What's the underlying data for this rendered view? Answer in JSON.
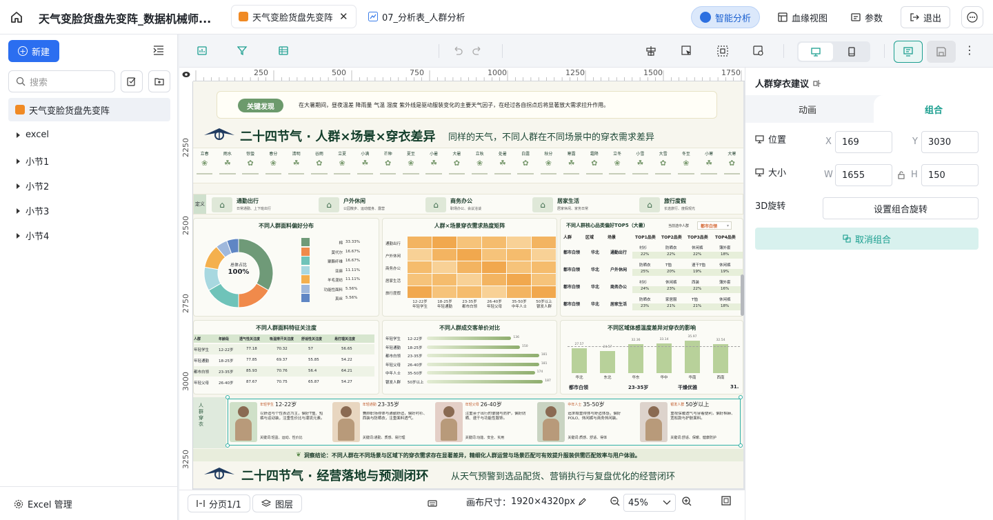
{
  "topbar": {
    "doc_title": "天气变脸货盘先变阵_数据机械师...",
    "tabs": [
      {
        "label": "天气变脸货盘先变阵",
        "active": true
      },
      {
        "label": "07_分析表_人群分析",
        "active": false
      }
    ],
    "smart_analysis": "智能分析",
    "lineage_view": "血缘视图",
    "params": "参数",
    "exit": "退出"
  },
  "sidebar": {
    "new_button": "新建",
    "search_placeholder": "搜索",
    "items": [
      {
        "label": "天气变脸货盘先变阵",
        "selected": true
      },
      {
        "label": "excel"
      },
      {
        "label": "小节1"
      },
      {
        "label": "小节2"
      },
      {
        "label": "小节3"
      },
      {
        "label": "小节4"
      }
    ],
    "excel_manage": "Excel 管理"
  },
  "rulers": {
    "top": [
      "250",
      "500",
      "750",
      "1000",
      "1250",
      "1500",
      "1750"
    ],
    "left": [
      "2250",
      "2500",
      "2750",
      "3000",
      "3250"
    ]
  },
  "report": {
    "key_finding_label": "关键发现",
    "key_finding_text": "在大暑期间，昼夜温差 降雨量 气温 湿度 紫外线是驱动服装变化的主要天气因子，在经过各自拐点后将显著放大需求拉升作用。",
    "section1_title": "二十四节气 · 人群×场景×穿衣差异",
    "section1_sub": "同样的天气，不同人群在不同场景中的穿衣需求差异",
    "solar_terms": [
      "立春",
      "雨水",
      "惊蛰",
      "春分",
      "清明",
      "谷雨",
      "立夏",
      "小满",
      "芒种",
      "夏至",
      "小暑",
      "大暑",
      "立秋",
      "处暑",
      "白露",
      "秋分",
      "寒露",
      "霜降",
      "立冬",
      "小雪",
      "大雪",
      "冬至",
      "小寒",
      "大寒"
    ],
    "scenes": [
      {
        "name": "通勤出行",
        "desc": "日常通勤、上下班出行"
      },
      {
        "name": "户外休闲",
        "desc": "公园散步、运动健身、露营"
      },
      {
        "name": "商务办公",
        "desc": "职场办公、会议洽谈"
      },
      {
        "name": "居家生活",
        "desc": "居家休闲、家务日常"
      },
      {
        "name": "旅行度假",
        "desc": "长途旅行、度假观光"
      }
    ],
    "scene_def_label": "定义",
    "donut_title": "不同人群面料偏好分布",
    "donut_center_label": "总体占比",
    "donut_center_value": "100%",
    "donut_legend": [
      {
        "name": "棉",
        "value": "33.33%",
        "color": "#6f9a78"
      },
      {
        "name": "莫代尔",
        "value": "16.67%",
        "color": "#f08a4b"
      },
      {
        "name": "聚酯纤维",
        "value": "16.67%",
        "color": "#6fc3b9"
      },
      {
        "name": "亚麻",
        "value": "11.11%",
        "color": "#a8d8e0"
      },
      {
        "name": "羊毛混纺",
        "value": "11.11%",
        "color": "#f4b04e"
      },
      {
        "name": "功能性面料",
        "value": "5.56%",
        "color": "#9fb8dc"
      },
      {
        "name": "真丝",
        "value": "5.56%",
        "color": "#5f86c4"
      }
    ],
    "heatmap_title": "人群×场景穿衣需求热度矩阵",
    "heatmap_rows": [
      "通勤出行",
      "户外休闲",
      "商务办公",
      "居家生活",
      "旅行度假"
    ],
    "heatmap_cols": [
      "12-22岁\n年轻学生",
      "18-25岁\n年轻通勤",
      "23-35岁\n都市白领",
      "26-40岁\n年轻父母",
      "35-50岁\n中年人士",
      "50岁以上\n银发人群"
    ],
    "top5_title": "不同人群核心品类偏好TOP5（大暑）",
    "top5_filter_label": "当前选中人群",
    "top5_filter_value": "都市白领",
    "top5_headers": [
      "人群",
      "区域",
      "场景",
      "TOP1品类",
      "TOP2品类",
      "TOP3品类",
      "TOP4品类"
    ],
    "top5_rows": [
      {
        "group": "都市白领",
        "region": "华北",
        "scene": "通勤出行",
        "items": [
          "衬衫",
          "防晒衣",
          "休闲裤",
          "薄外套"
        ],
        "pcts": [
          "22%",
          "22%",
          "22%",
          "18%"
        ]
      },
      {
        "group": "都市白领",
        "region": "华北",
        "scene": "户外休闲",
        "items": [
          "防晒衣",
          "T恤",
          "速干T恤",
          "休闲裤"
        ],
        "pcts": [
          "25%",
          "20%",
          "19%",
          "19%"
        ]
      },
      {
        "group": "都市白领",
        "region": "华北",
        "scene": "商务办公",
        "items": [
          "衬衫",
          "休闲裤",
          "西装",
          "薄外套"
        ],
        "pcts": [
          "24%",
          "23%",
          "22%",
          "16%"
        ]
      },
      {
        "group": "都市白领",
        "region": "华北",
        "scene": "居家生活",
        "items": [
          "防晒衣",
          "家居服",
          "T恤",
          "休闲裤"
        ],
        "pcts": [
          "23%",
          "21%",
          "21%",
          "18%"
        ]
      }
    ],
    "fabric_table_title": "不同人群面料特征关注度",
    "fabric_headers": [
      "人群",
      "年龄段",
      "透气性关注度",
      "吸湿排汗关注度",
      "舒适性关注度",
      "易打理关注度"
    ],
    "fabric_rows": [
      [
        "年轻学生",
        "12-22岁",
        "77.18",
        "70.32",
        "57",
        "56.65"
      ],
      [
        "年轻通勤",
        "18-25岁",
        "77.85",
        "69.37",
        "55.85",
        "54.22"
      ],
      [
        "都市白领",
        "23-35岁",
        "85.93",
        "70.76",
        "56.4",
        "64.21"
      ],
      [
        "年轻父母",
        "26-40岁",
        "87.67",
        "70.75",
        "65.87",
        "54.27"
      ]
    ],
    "price_title": "不同人群成交客单价对比",
    "price_rows": [
      {
        "group": "年轻学生",
        "age": "12-22岁",
        "value": 136
      },
      {
        "group": "年轻通勤",
        "age": "18-25岁",
        "value": 150
      },
      {
        "group": "都市白领",
        "age": "23-35岁",
        "value": 181
      },
      {
        "group": "年轻父母",
        "age": "26-40岁",
        "value": 181
      },
      {
        "group": "中年人士",
        "age": "35-50岁",
        "value": 174
      },
      {
        "group": "银发人群",
        "age": "50岁以上",
        "value": 187
      }
    ],
    "temp_title": "不同区域体感温度差异对穿衣的影响",
    "temp_bars": [
      {
        "label": "华北",
        "value": 27.57
      },
      {
        "label": "东北",
        "value": 24.57
      },
      {
        "label": "华东",
        "value": 32.36
      },
      {
        "label": "华中",
        "value": 33.14
      },
      {
        "label": "华南",
        "value": 35.97
      },
      {
        "label": "西南",
        "value": 32.54
      }
    ],
    "temp_footer": [
      "都市白领",
      "23-35岁",
      "干燥优雅",
      "31."
    ],
    "persona_side_label": "人群穿衣",
    "personas": [
      {
        "tag": "年轻学生",
        "age": "12-22岁",
        "desc": "以舒适与个性表达为主，偏好T恤、短裤与运动装，注重性价比与潮流元素。",
        "keys": "关键词:轻盈、运动、性价比"
      },
      {
        "tag": "年轻通勤",
        "age": "23-35岁",
        "desc": "兼顾职场得体与通勤舒适，偏好衬衫、西装与防晒衣，注重面料透气。",
        "keys": "关键词:通勤、质感、易打理"
      },
      {
        "tag": "年轻父母",
        "age": "26-40岁",
        "desc": "注重亲子出行的便捷与防护，偏好防晒、速干与功能性服饰。",
        "keys": "关键词:功能、安全、实用"
      },
      {
        "tag": "中年人士",
        "age": "35-50岁",
        "desc": "追求稳重得体与舒适体感，偏好POLO、休闲裤与商务休闲装。",
        "keys": "关键词:质感、舒适、得体"
      },
      {
        "tag": "银发人群",
        "age": "50岁以上",
        "desc": "重视保暖透气与穿着便利，偏好棉麻、宽松款与护肤面料。",
        "keys": "关键词:舒适、保暖、健康防护"
      }
    ],
    "conclusion": "洞察结论：不同人群在不同场景与区域下的穿衣需求存在显著差异，精细化人群运营与场景匹配可有效提升服装供需匹配效率与用户体验。",
    "section2_title": "二十四节气 · 经营落地与预测闭环",
    "section2_sub": "从天气预警到选品配货、营销执行与复盘优化的经营闭环"
  },
  "bottombar": {
    "pages": "分页1/1",
    "layers": "图层",
    "canvas_size_label": "画布尺寸：",
    "canvas_size_value": "1920×4320px",
    "zoom": "45%"
  },
  "rightpanel": {
    "component_title": "人群穿衣建议",
    "tabs": [
      {
        "label": "动画",
        "active": false
      },
      {
        "label": "组合",
        "active": true
      }
    ],
    "position_label": "位置",
    "x_label": "X",
    "x_value": "169",
    "y_label": "Y",
    "y_value": "3030",
    "size_label": "大小",
    "w_label": "W",
    "w_value": "1655",
    "h_label": "H",
    "h_value": "150",
    "rotate_label": "3D旋转",
    "rotate_button": "设置组合旋转",
    "ungroup_button": "取消组合"
  },
  "colors": {
    "accent": "#1a73e8",
    "teal": "#1a9e8f",
    "report_green": "#2d5a3f"
  }
}
